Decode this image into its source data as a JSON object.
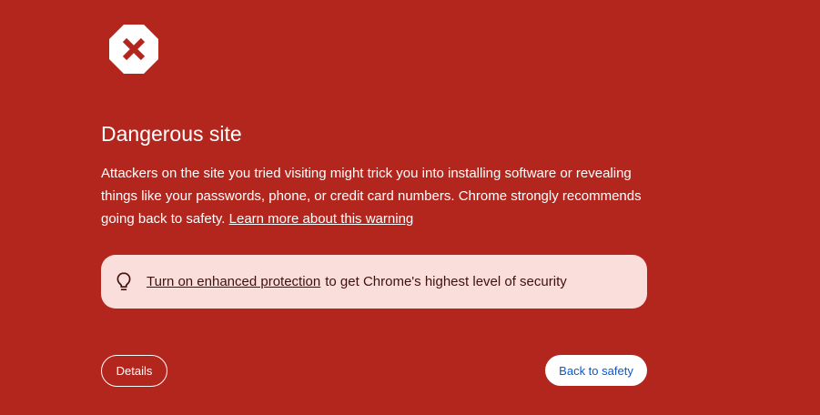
{
  "colors": {
    "background": "#b3261e",
    "promo_background": "#f9dedc",
    "promo_text": "#41100c",
    "primary_button_text": "#0b57d0"
  },
  "warning": {
    "icon": "danger-octagon-x-icon",
    "title": "Dangerous site",
    "body": "Attackers on the site you tried visiting might trick you into installing software or revealing things like your passwords, phone, or credit card numbers. Chrome strongly recommends going back to safety. ",
    "learn_more_link": "Learn more about this warning"
  },
  "promo": {
    "icon": "lightbulb-icon",
    "link_text": "Turn on enhanced protection",
    "text": "to get Chrome's highest level of security"
  },
  "buttons": {
    "details": "Details",
    "back_to_safety": "Back to safety"
  }
}
